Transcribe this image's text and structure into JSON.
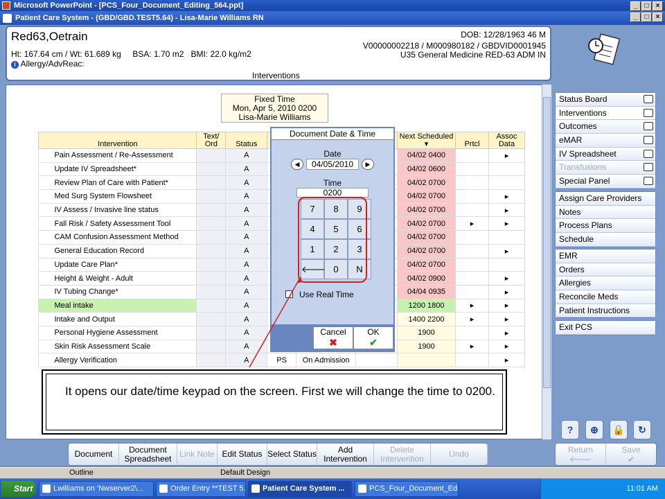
{
  "ppt": {
    "title": "Microsoft PowerPoint - [PCS_Four_Document_Editing_564.ppt]",
    "status_left": "Outline",
    "status_mid": "Default Design"
  },
  "window": {
    "title": "Patient Care System - (GBD/GBD.TEST5.64) - Lisa-Marie Williams RN"
  },
  "patient": {
    "name": "Red63,Oetrain",
    "vitals": "Ht: 167.64 cm / Wt: 61.689 kg     BSA: 1.70 m2   BMI: 22.0 kg/m2",
    "allergy": "Allergy/AdvReac:",
    "dob": "DOB: 12/28/1963 46 M",
    "ids": "V00000002218 / M000980182 / GBDVID0001945",
    "location": "U35 General Medicine  RED-63  ADM IN",
    "section": "Interventions"
  },
  "fixed_time": {
    "label": "Fixed Time",
    "date": "Mon, Apr 5, 2010  0200",
    "user": "Lisa-Marie Williams"
  },
  "table": {
    "headers": {
      "intervention": "Intervention",
      "text_ord": "Text/ Ord",
      "status": "Status",
      "next_scheduled": "Next Scheduled",
      "prtcl": "Prtcl",
      "assoc_data": "Assoc Data"
    },
    "rows": [
      {
        "name": "Pain Assessment / Re-Assessment",
        "status": "A",
        "next": "04/02 0400",
        "prtcl": "",
        "assoc": "▸"
      },
      {
        "name": "Update IV Spreadsheet*",
        "status": "A",
        "next": "04/02 0600",
        "prtcl": "",
        "assoc": ""
      },
      {
        "name": "Review Plan of Care with Patient*",
        "status": "A",
        "next": "04/02 0700",
        "prtcl": "",
        "assoc": ""
      },
      {
        "name": "Med Surg System Flowsheet",
        "status": "A",
        "next": "04/02 0700",
        "prtcl": "",
        "assoc": "▸"
      },
      {
        "name": "IV Assess / Invasive line status",
        "status": "A",
        "next": "04/02 0700",
        "prtcl": "",
        "assoc": "▸"
      },
      {
        "name": "Fall Risk / Safety Assessment Tool",
        "status": "A",
        "next": "04/02 0700",
        "prtcl": "▸",
        "assoc": "▸"
      },
      {
        "name": "CAM Confusion Assessment Method",
        "status": "A",
        "next": "04/02 0700",
        "prtcl": "",
        "assoc": ""
      },
      {
        "name": "General Education Record",
        "status": "A",
        "next": "04/02 0700",
        "prtcl": "",
        "assoc": "▸"
      },
      {
        "name": "Update Care Plan*",
        "status": "A",
        "next": "04/02 0700",
        "prtcl": "",
        "assoc": ""
      },
      {
        "name": "Height & Weight - Adult",
        "status": "A",
        "next": "04/02 0900",
        "prtcl": "",
        "assoc": "▸"
      },
      {
        "name": "IV Tubing Change*",
        "status": "A",
        "next": "04/04 0935",
        "prtcl": "",
        "assoc": "▸"
      },
      {
        "name": "Meal intake",
        "status": "A",
        "next": "1200 1800",
        "prtcl": "▸",
        "assoc": "▸"
      },
      {
        "name": "Intake and Output",
        "status": "A",
        "next": "1400 2200",
        "prtcl": "▸",
        "assoc": "▸"
      },
      {
        "name": "Personal Hygiene Assessment",
        "status": "A",
        "next": "1900",
        "prtcl": "",
        "assoc": "▸"
      },
      {
        "name": "Skin Risk Assessment Scale",
        "status": "A",
        "next": "1900",
        "prtcl": "▸",
        "assoc": "▸"
      },
      {
        "name": "Allergy Verification",
        "status": "A",
        "next": "",
        "prtcl": "",
        "assoc": "▸"
      }
    ],
    "last_row_extra": {
      "ps": "PS",
      "on_admission": "On Admission"
    }
  },
  "dialog": {
    "title": "Document Date & Time",
    "date_label": "Date",
    "date_value": "04/05/2010",
    "time_label": "Time",
    "time_value": "0200",
    "keys": [
      "7",
      "8",
      "9",
      "4",
      "5",
      "6",
      "1",
      "2",
      "3",
      "🡐",
      "0",
      "N"
    ],
    "use_real_time": "Use Real Time",
    "cancel": "Cancel",
    "ok": "OK"
  },
  "callout": "It opens our date/time keypad on the screen. First we will change the time to 0200.",
  "nav": {
    "group1": [
      "Status Board",
      "Interventions",
      "Outcomes",
      "eMAR",
      "IV Spreadsheet",
      "Transfusions",
      "Special Panel"
    ],
    "group2": [
      "Assign Care Providers",
      "Notes",
      "Process Plans",
      "Schedule"
    ],
    "group3": [
      "EMR",
      "Orders",
      "Allergies",
      "Reconcile Meds",
      "Patient Instructions"
    ],
    "group4": [
      "Exit PCS"
    ]
  },
  "toolbar": [
    {
      "label": "Document",
      "enabled": true
    },
    {
      "label": "Document Spreadsheet",
      "enabled": true
    },
    {
      "label": "Link Note",
      "enabled": false
    },
    {
      "label": "Edit Status",
      "enabled": true
    },
    {
      "label": "Select Status",
      "enabled": true
    },
    {
      "label": "Add Intervention",
      "enabled": true
    },
    {
      "label": "Delete Intervention",
      "enabled": false
    },
    {
      "label": "Undo",
      "enabled": false
    }
  ],
  "return_label": "Return",
  "save_label": "Save",
  "taskbar": {
    "start": "Start",
    "tasks": [
      "Lwilliams on 'Nwserver2\\...",
      "Order Entry **TEST 5.6....",
      "Patient Care System ...",
      "PCS_Four_Document_Ed..."
    ],
    "clock": "11:01 AM"
  },
  "colors": {
    "accent": "#2050b8",
    "pink": "#f8c8c8",
    "green": "#c8f0b0",
    "callout_border": "#d02020"
  }
}
